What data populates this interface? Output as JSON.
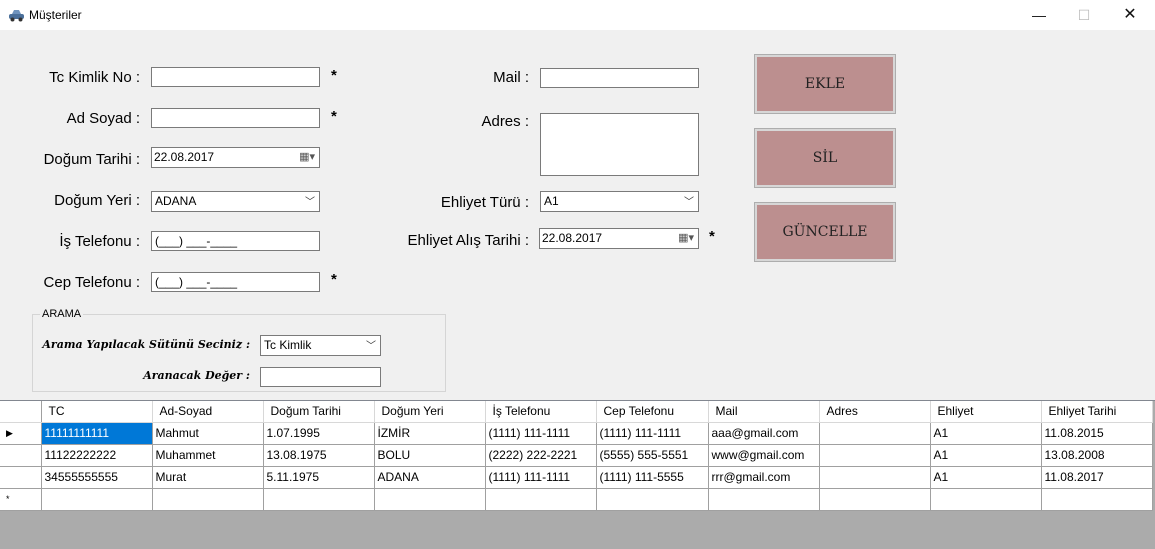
{
  "window": {
    "title": "Müşteriler",
    "icon": "car-icon",
    "controls": {
      "minimize": "—",
      "maximize": "☐",
      "close": "✕"
    }
  },
  "form": {
    "tc_label": "Tc Kimlik No :",
    "tc_value": "",
    "adsoyad_label": "Ad Soyad :",
    "adsoyad_value": "",
    "dogum_tarihi_label": "Doğum Tarihi :",
    "dogum_tarihi_value": "22.08.2017",
    "dogum_yeri_label": "Doğum Yeri :",
    "dogum_yeri_value": "ADANA",
    "is_tel_label": "İş Telefonu :",
    "is_tel_value": "(___) ___-____",
    "cep_tel_label": "Cep Telefonu :",
    "cep_tel_value": "(___) ___-____",
    "mail_label": "Mail :",
    "mail_value": "",
    "adres_label": "Adres :",
    "adres_value": "",
    "ehliyet_turu_label": "Ehliyet Türü :",
    "ehliyet_turu_value": "A1",
    "ehliyet_alis_label": "Ehliyet Alış Tarihi :",
    "ehliyet_alis_value": "22.08.2017",
    "required_mark": "*"
  },
  "buttons": {
    "ekle": "EKLE",
    "sil": "SİL",
    "guncelle": "GÜNCELLE"
  },
  "search": {
    "group_title": "ARAMA",
    "column_label": "Arama Yapılacak Sütünü Seciniz :",
    "column_value": "Tc Kimlik",
    "value_label": "Aranacak Değer :",
    "value_value": ""
  },
  "grid": {
    "columns": [
      "TC",
      "Ad-Soyad",
      "Doğum Tarihi",
      "Doğum Yeri",
      "İş Telefonu",
      "Cep Telefonu",
      "Mail",
      "Adres",
      "Ehliyet",
      "Ehliyet Tarihi"
    ],
    "rows": [
      [
        "11111111111",
        "Mahmut",
        "1.07.1995",
        "İZMİR",
        "(1111) 111-1111",
        "(1111) 111-1111",
        "aaa@gmail.com",
        "",
        "A1",
        "11.08.2015"
      ],
      [
        "11122222222",
        "Muhammet",
        "13.08.1975",
        "BOLU",
        "(2222) 222-2221",
        "(5555) 555-5551",
        "www@gmail.com",
        "",
        "A1",
        "13.08.2008"
      ],
      [
        "34555555555",
        "Murat",
        "5.11.1975",
        "ADANA",
        "(1111) 111-1111",
        "(1111) 111-5555",
        "rrr@gmail.com",
        "",
        "A1",
        "11.08.2017"
      ]
    ],
    "current_row_marker": "▶",
    "new_row_marker": "*",
    "accent_selected": "#0078d7"
  },
  "colors": {
    "button_bg": "#bc8f8f",
    "form_bg": "#f0f0f0"
  }
}
